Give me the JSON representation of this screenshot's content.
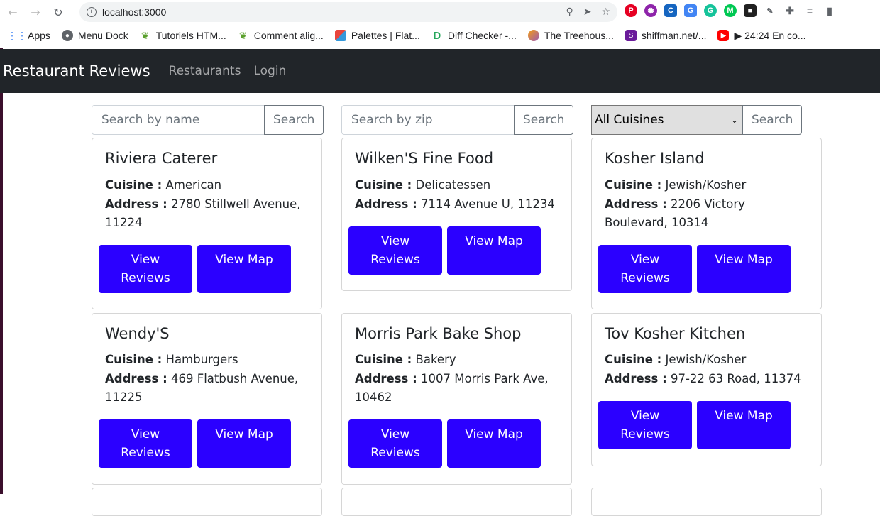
{
  "browser": {
    "url": "localhost:3000",
    "bookmarks": [
      {
        "label": "Apps",
        "icon": "apps-grid-icon",
        "color": "#4285f4"
      },
      {
        "label": "Menu Dock",
        "icon": "globe-icon",
        "color": "#5f6368"
      },
      {
        "label": "Tutoriels HTM...",
        "icon": "leaf-icon",
        "color": "#5aa02c"
      },
      {
        "label": "Comment alig...",
        "icon": "leaf-icon",
        "color": "#5aa02c"
      },
      {
        "label": "Palettes | Flat...",
        "icon": "palette-icon",
        "color": "#e8453c"
      },
      {
        "label": "Diff Checker -...",
        "icon": "diff-icon",
        "color": "#26a65b"
      },
      {
        "label": "The Treehous...",
        "icon": "treehouse-icon",
        "color": "#9b59b6"
      },
      {
        "label": "shiffman.net/...",
        "icon": "s-icon",
        "color": "#6a1b9a"
      },
      {
        "label": "▶ 24:24 En co...",
        "icon": "youtube-icon",
        "color": "#ff0000"
      }
    ]
  },
  "navbar": {
    "brand": "Restaurant Reviews",
    "links": [
      "Restaurants",
      "Login"
    ]
  },
  "search": {
    "name_placeholder": "Search by name",
    "zip_placeholder": "Search by zip",
    "button_label": "Search",
    "cuisine_selected": "All Cuisines"
  },
  "labels": {
    "cuisine": "Cuisine :",
    "address": "Address :",
    "view_reviews": "View Reviews",
    "view_map": "View Map"
  },
  "restaurants": [
    {
      "name": "Riviera Caterer",
      "cuisine": "American",
      "address": "2780 Stillwell Avenue, 11224"
    },
    {
      "name": "Wilken'S Fine Food",
      "cuisine": "Delicatessen",
      "address": "7114 Avenue U, 11234"
    },
    {
      "name": "Kosher Island",
      "cuisine": "Jewish/Kosher",
      "address": "2206 Victory Boulevard, 10314"
    },
    {
      "name": "Wendy'S",
      "cuisine": "Hamburgers",
      "address": "469 Flatbush Avenue, 11225"
    },
    {
      "name": "Morris Park Bake Shop",
      "cuisine": "Bakery",
      "address": "1007 Morris Park Ave, 10462"
    },
    {
      "name": "Tov Kosher Kitchen",
      "cuisine": "Jewish/Kosher",
      "address": "97-22 63 Road, 11374"
    }
  ],
  "colors": {
    "navbar_bg": "#212529",
    "button_bg": "#2b00ff"
  }
}
